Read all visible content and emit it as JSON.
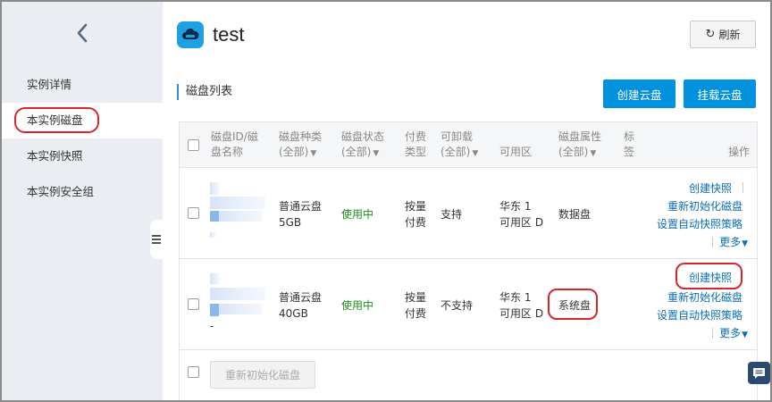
{
  "sidebar": {
    "back_icon": "chevron-left-icon",
    "items": [
      {
        "label": "实例详情"
      },
      {
        "label": "本实例磁盘"
      },
      {
        "label": "本实例快照"
      },
      {
        "label": "本实例安全组"
      }
    ],
    "active_index": 1
  },
  "header": {
    "app_icon": "cloud-disk-icon",
    "title": "test",
    "refresh_label": "刷新"
  },
  "section": {
    "title": "磁盘列表",
    "create_button": "创建云盘",
    "attach_button": "挂载云盘"
  },
  "table": {
    "columns": {
      "disk_id_line1": "磁盘ID/磁",
      "disk_id_line2": "盘名称",
      "type_line1": "磁盘种类",
      "type_line2": "(全部)",
      "status_line1": "磁盘状态",
      "status_line2": "(全部)",
      "billing_line1": "付费",
      "billing_line2": "类型",
      "detachable_line1": "可卸载",
      "detachable_line2": "(全部)",
      "zone": "可用区",
      "attr_line1": "磁盘属性",
      "attr_line2": "(全部)",
      "tag_line1": "标",
      "tag_line2": "签",
      "actions": "操作"
    },
    "rows": [
      {
        "type_line1": "普通云盘",
        "type_line2": "5GB",
        "status": "使用中",
        "billing_line1": "按量",
        "billing_line2": "付费",
        "detachable": "支持",
        "zone_line1": "华东 1",
        "zone_line2": "可用区 D",
        "attribute": "数据盘",
        "actions": [
          "创建快照",
          "重新初始化磁盘",
          "设置自动快照策略"
        ],
        "more": "更多"
      },
      {
        "type_line1": "普通云盘",
        "type_line2": "40GB",
        "status": "使用中",
        "billing_line1": "按量",
        "billing_line2": "付费",
        "detachable": "不支持",
        "zone_line1": "华东 1",
        "zone_line2": "可用区 D",
        "attribute": "系统盘",
        "dash": "-",
        "actions": [
          "创建快照",
          "重新初始化磁盘",
          "设置自动快照策略"
        ],
        "more": "更多"
      }
    ],
    "footer_button": "重新初始化磁盘"
  },
  "colors": {
    "primary": "#0092dd",
    "status_green": "#199019",
    "link": "#0b6fb5",
    "highlight_ring": "#d6262b",
    "sidebar_bg": "#eaedf1"
  }
}
